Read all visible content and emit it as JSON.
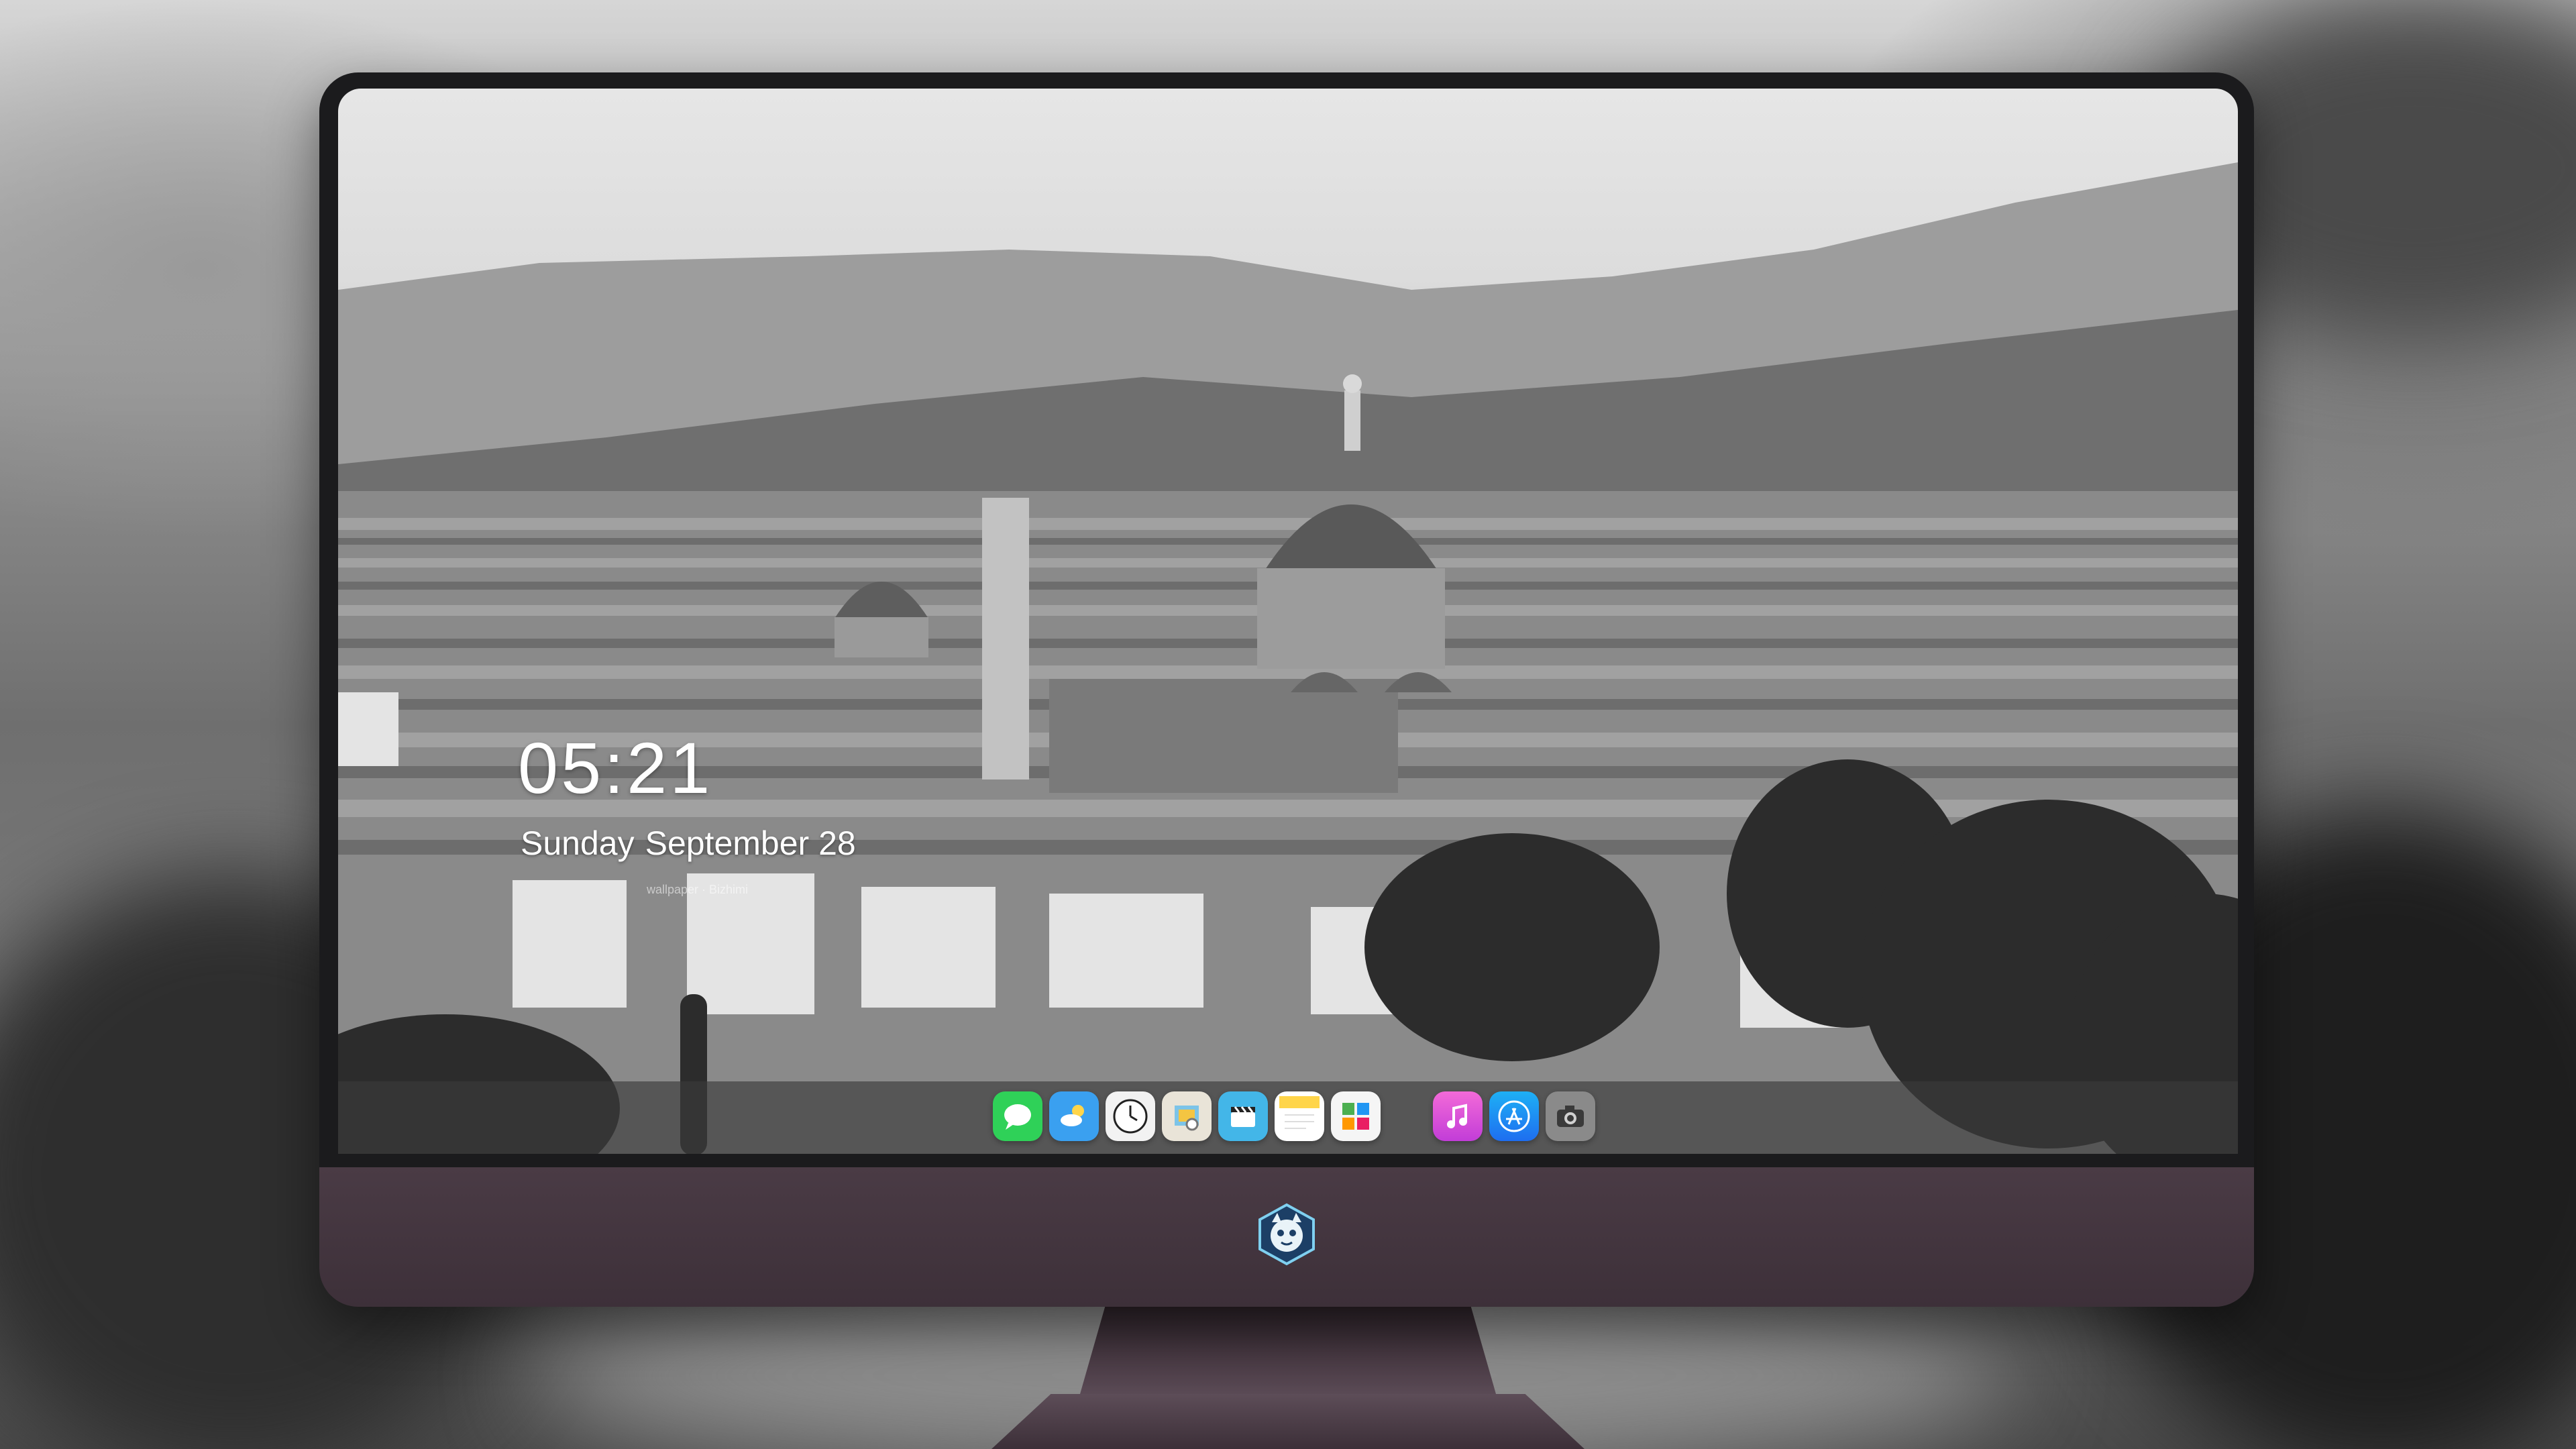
{
  "lock_screen": {
    "time": "05:21",
    "weekday": "Sunday",
    "date": "September 28",
    "credit": "wallpaper · Bizhimi"
  },
  "dock": {
    "apps": [
      {
        "name": "Messages",
        "icon": "messages-icon",
        "color": "#2fd158"
      },
      {
        "name": "Weather",
        "icon": "weather-icon",
        "color": "#3aa0f0"
      },
      {
        "name": "Clock",
        "icon": "clock-icon",
        "color": "#f2f2f2"
      },
      {
        "name": "Preview",
        "icon": "preview-icon",
        "color": "#e9e4d8"
      },
      {
        "name": "Clips",
        "icon": "clips-icon",
        "color": "#43b6e8"
      },
      {
        "name": "Notes",
        "icon": "notes-icon",
        "color": "#ffd54a"
      },
      {
        "name": "Photo Gallery",
        "icon": "gallery-icon",
        "color": "#f5f5f5"
      },
      {
        "name": "Music",
        "icon": "music-icon",
        "color": "#f05ad0"
      },
      {
        "name": "App Store",
        "icon": "app-store-icon",
        "color": "#1e8cf0"
      },
      {
        "name": "Camera",
        "icon": "camera-icon",
        "color": "#8a8a8a"
      }
    ]
  },
  "device": {
    "logo": "mascot-logo-icon"
  }
}
